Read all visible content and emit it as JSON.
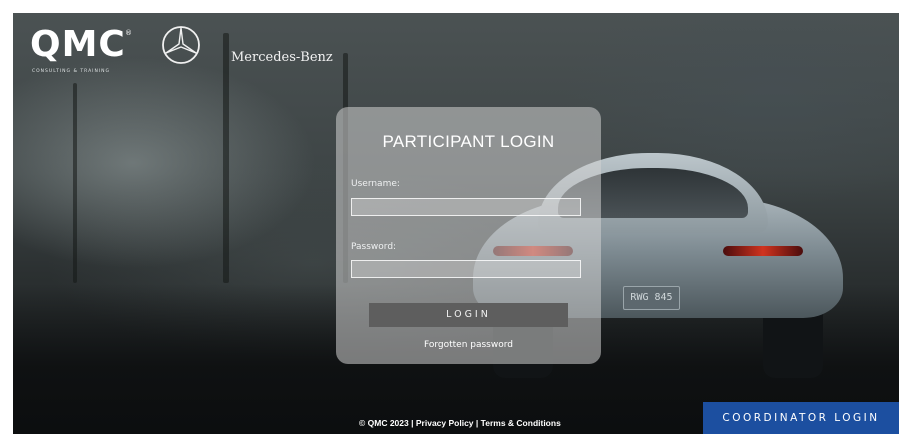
{
  "header": {
    "qmc_logo_text": "QMC",
    "qmc_reg_mark": "®",
    "qmc_subtitle": "CONSULTING & TRAINING",
    "brand_text": "Mercedes-Benz"
  },
  "login": {
    "title": "PARTICIPANT LOGIN",
    "username_label": "Username:",
    "username_value": "",
    "password_label": "Password:",
    "password_value": "",
    "login_button": "LOGIN",
    "forgot_link": "Forgotten password"
  },
  "car": {
    "plate_text": "RWG 845"
  },
  "footer": {
    "copyright": "© QMC 2023",
    "separator": "|",
    "privacy": "Privacy Policy",
    "terms": "Terms & Conditions"
  },
  "coordinator_button": "COORDINATOR LOGIN",
  "colors": {
    "accent_button": "#1c4fa0",
    "login_button": "#5e5e5e",
    "panel": "rgba(210,210,210,0.55)"
  }
}
